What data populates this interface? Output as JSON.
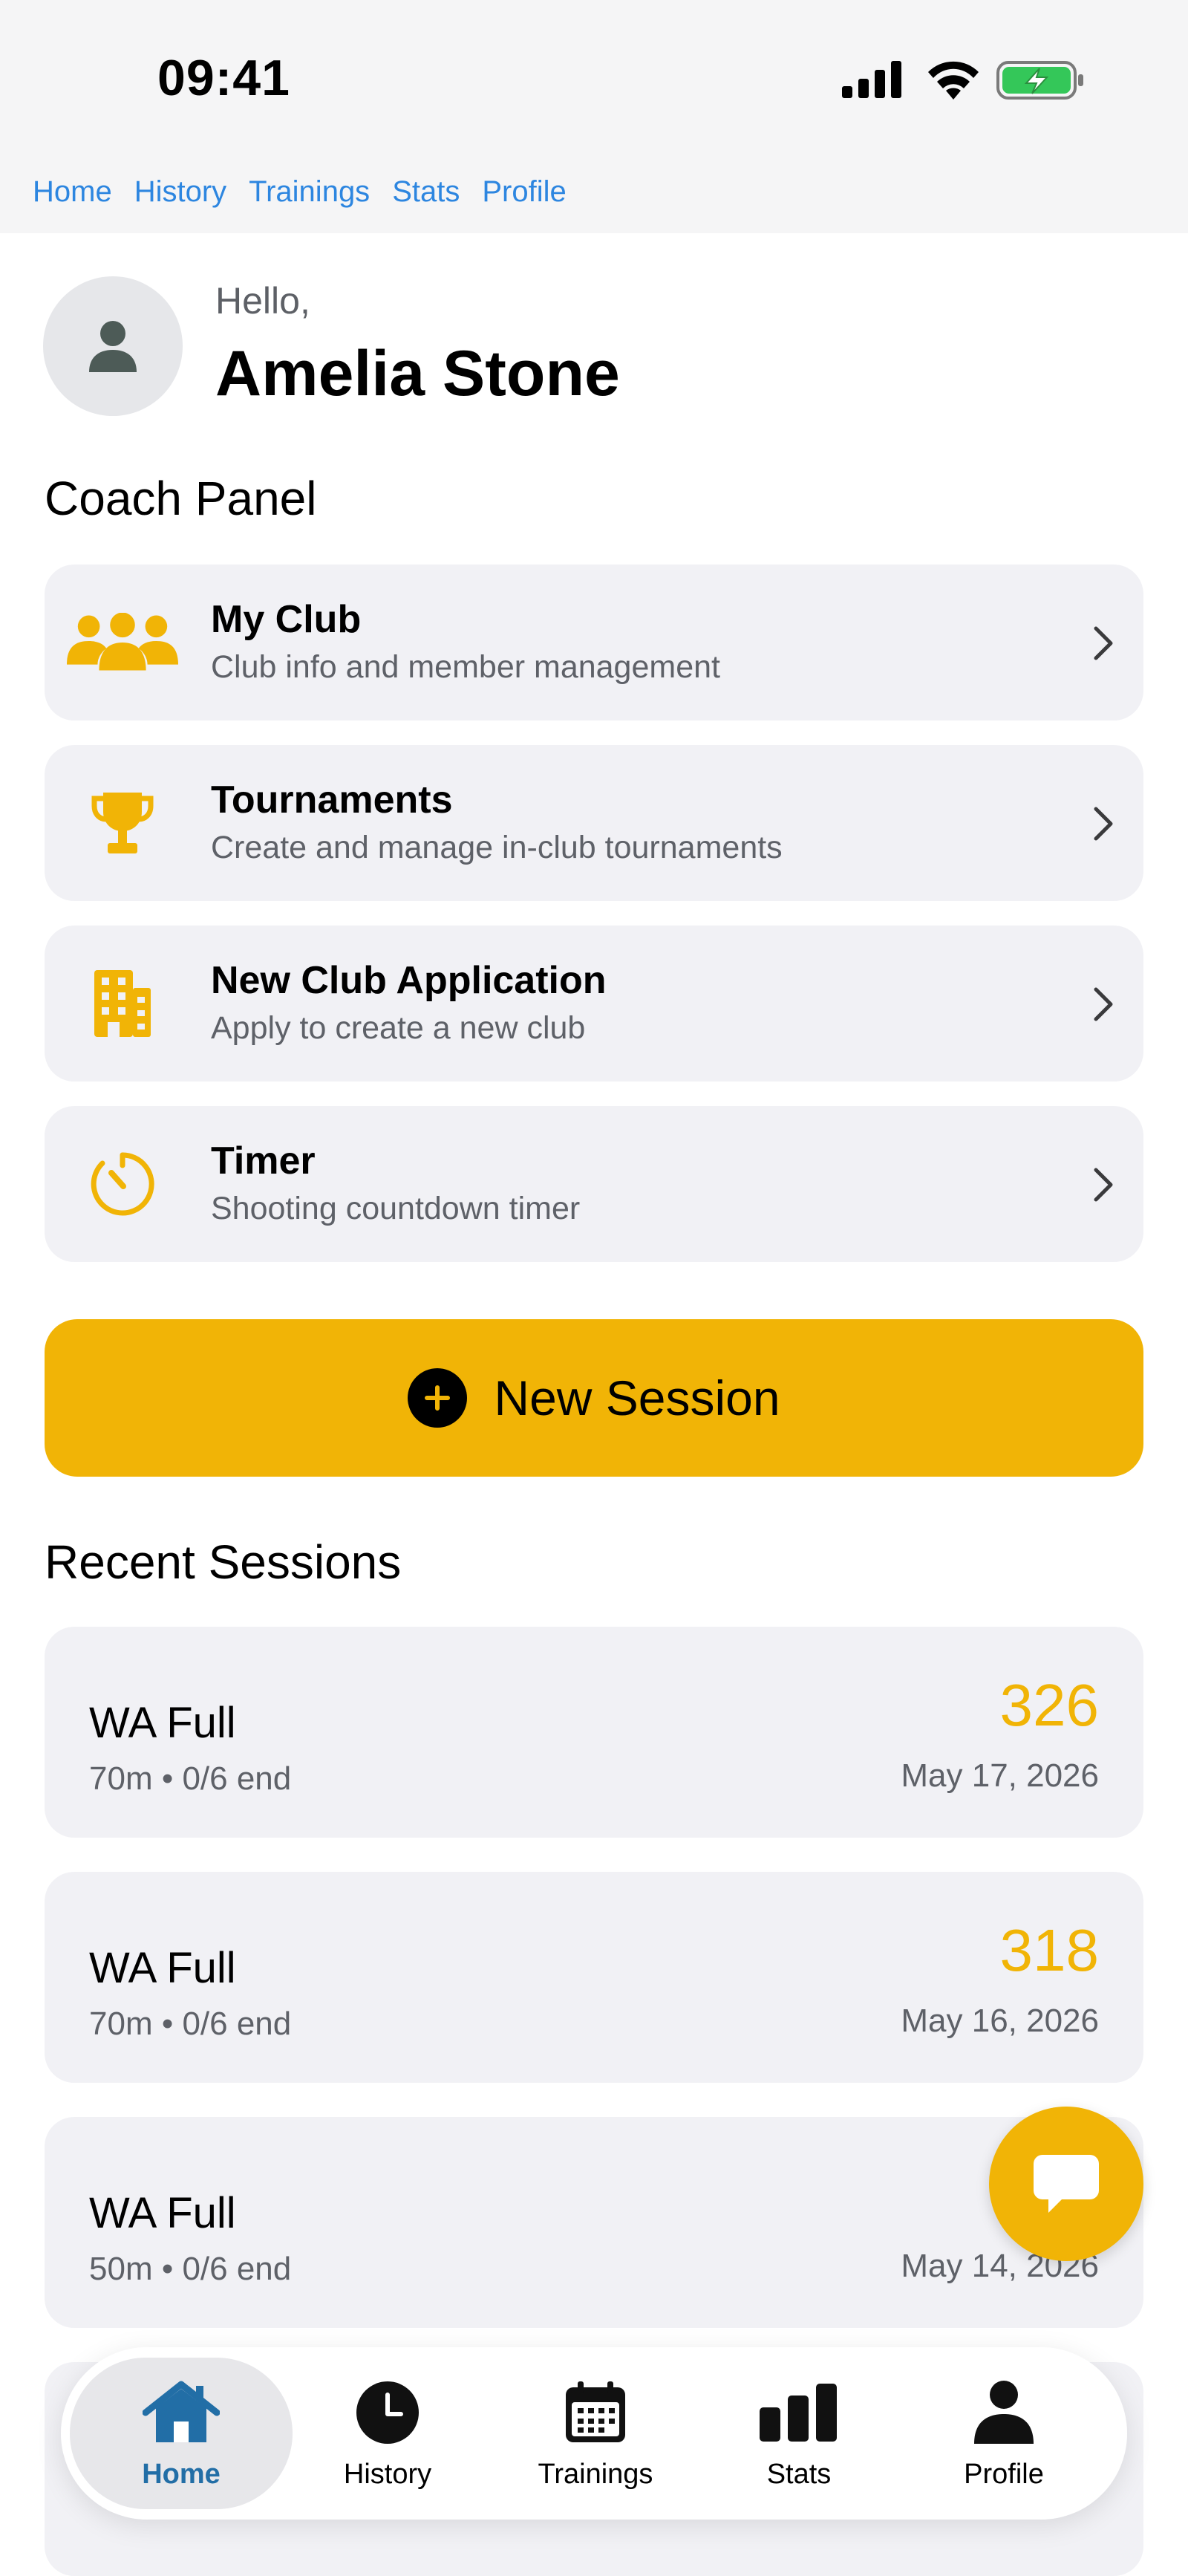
{
  "status": {
    "time": "09:41"
  },
  "webnav": [
    "Home",
    "History",
    "Trainings",
    "Stats",
    "Profile"
  ],
  "greeting": {
    "hello": "Hello,",
    "name": "Amelia Stone"
  },
  "coach_panel": {
    "title": "Coach Panel",
    "items": [
      {
        "title": "My Club",
        "subtitle": "Club info and member management",
        "icon": "people-group-icon"
      },
      {
        "title": "Tournaments",
        "subtitle": "Create and manage in-club tournaments",
        "icon": "trophy-icon"
      },
      {
        "title": "New Club Application",
        "subtitle": "Apply to create a new club",
        "icon": "building-icon"
      },
      {
        "title": "Timer",
        "subtitle": "Shooting countdown timer",
        "icon": "timer-icon"
      }
    ]
  },
  "new_session": {
    "label": "New Session"
  },
  "recent": {
    "title": "Recent Sessions",
    "sessions": [
      {
        "name": "WA Full",
        "meta": "70m • 0/6 end",
        "score": "326",
        "date": "May 17, 2026"
      },
      {
        "name": "WA Full",
        "meta": "70m • 0/6 end",
        "score": "318",
        "date": "May 16, 2026"
      },
      {
        "name": "WA Full",
        "meta": "50m • 0/6 end",
        "score": "",
        "date": "May 14, 2026"
      }
    ]
  },
  "tabbar": {
    "active": "Home",
    "tabs": [
      {
        "label": "Home",
        "icon": "home-icon"
      },
      {
        "label": "History",
        "icon": "clock-icon"
      },
      {
        "label": "Trainings",
        "icon": "calendar-icon"
      },
      {
        "label": "Stats",
        "icon": "bar-chart-icon"
      },
      {
        "label": "Profile",
        "icon": "person-icon"
      }
    ]
  },
  "colors": {
    "accent": "#f1b406",
    "link": "#2d86e0",
    "active_tab": "#226ea6",
    "card_bg": "#f1f1f5",
    "secondary_text": "#5e6168"
  }
}
